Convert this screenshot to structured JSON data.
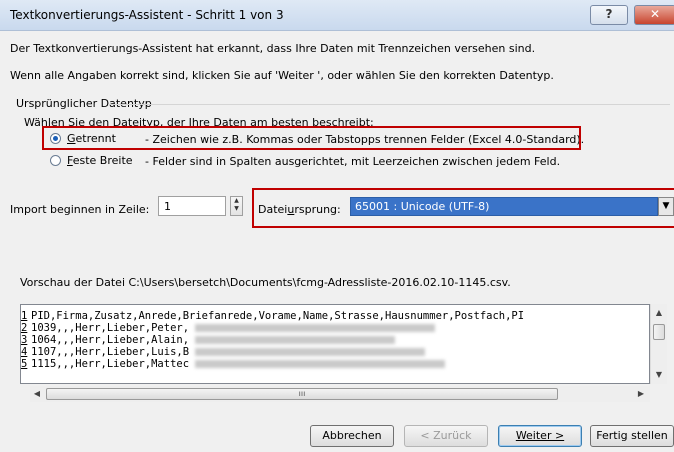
{
  "window": {
    "title": "Textkonvertierungs-Assistent - Schritt 1 von 3",
    "help_label": "?",
    "close_label": "✕"
  },
  "intro": {
    "line1": "Der Textkonvertierungs-Assistent hat erkannt, dass Ihre Daten mit Trennzeichen versehen sind.",
    "line2": "Wenn alle Angaben korrekt sind, klicken Sie auf 'Weiter ', oder wählen Sie den korrekten Datentyp."
  },
  "datatype_group": {
    "label": "Ursprünglicher Datentyp",
    "prompt": "Wählen Sie den Dateityp, der Ihre Daten am besten beschreibt:",
    "options": [
      {
        "first": "G",
        "rest": "etrennt",
        "desc": "- Zeichen wie z.B. Kommas oder Tabstopps trennen Felder (Excel 4.0-Standard).",
        "selected": true
      },
      {
        "first": "F",
        "rest": "este Breite",
        "desc": "- Felder sind in Spalten ausgerichtet, mit Leerzeichen zwischen jedem Feld.",
        "selected": false
      }
    ]
  },
  "import": {
    "start_row_label": "Import beginnen in Zeile:",
    "start_row_value": "1",
    "origin_label_pre": "Datei",
    "origin_label_u": "u",
    "origin_label_post": "rsprung:",
    "origin_value": "65001 : Unicode (UTF-8)"
  },
  "preview": {
    "label": "Vorschau der Datei C:\\Users\\bersetch\\Documents\\fcmg-Adressliste-2016.02.10-1145.csv.",
    "rows": [
      {
        "num": "1",
        "text": "PID,Firma,Zusatz,Anrede,Briefanrede,Vorame,Name,Strasse,Hausnummer,Postfach,PI"
      },
      {
        "num": "2",
        "text": "1039,,,Herr,Lieber,Peter,"
      },
      {
        "num": "3",
        "text": "1064,,,Herr,Lieber,Alain,"
      },
      {
        "num": "4",
        "text": "1107,,,Herr,Lieber,Luis,B"
      },
      {
        "num": "5",
        "text": "1115,,,Herr,Lieber,Mattec"
      }
    ]
  },
  "buttons": {
    "cancel": "Abbrechen",
    "back": "< Zurück",
    "next": "Weiter >",
    "finish": "Fertig stellen"
  }
}
